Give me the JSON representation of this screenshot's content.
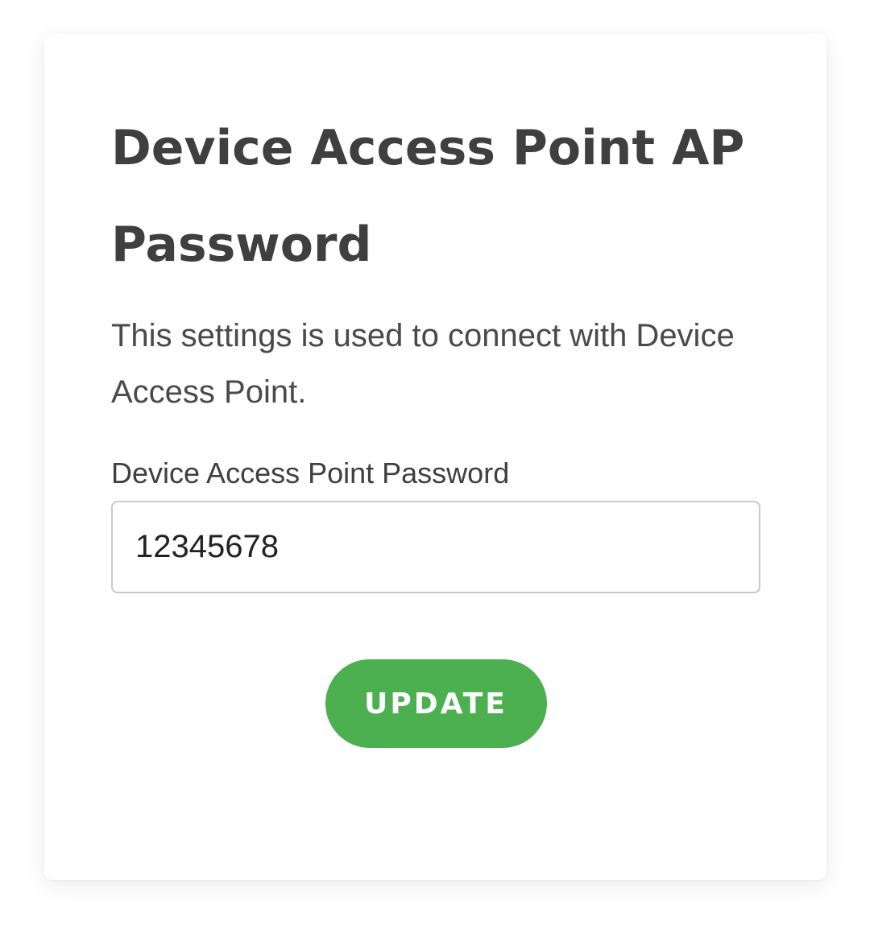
{
  "card": {
    "title": "Device Access Point AP Password",
    "description": "This settings is used to connect with Device Access Point.",
    "field": {
      "label": "Device Access Point Password",
      "value": "12345678"
    },
    "update_label": "UPDATE"
  },
  "colors": {
    "accent": "#4caf50",
    "text": "#3f3f3f",
    "input_border": "#c9c9c9"
  }
}
